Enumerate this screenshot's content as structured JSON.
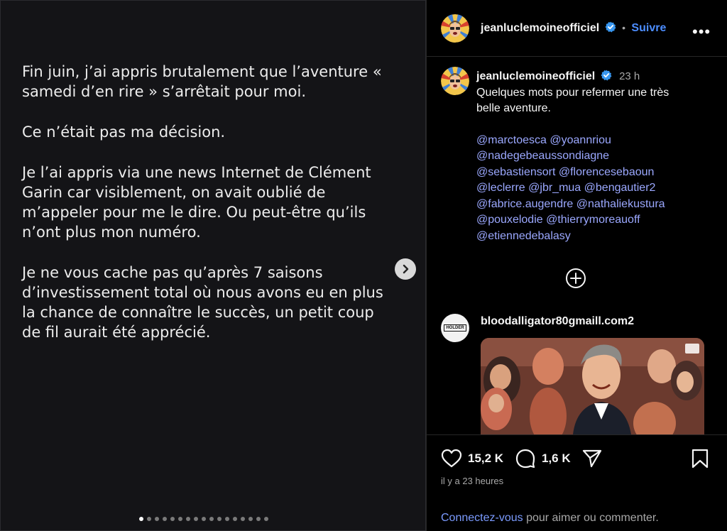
{
  "slide": {
    "paragraphs": [
      "Fin juin, j’ai appris brutalement que l’aventure « samedi d’en rire » s’arrêtait pour moi.",
      "Ce n’était pas ma décision.",
      "Je l’ai appris via une news Internet de Clément Garin car visiblement, on avait oublié de m’appeler pour me le dire. Ou peut-être qu’ils n’ont plus mon numéro.",
      "Je ne vous cache pas qu’après 7 saisons d’investissement total où nous avons eu en plus la chance de connaître le succès, un petit coup de fil aurait été apprécié."
    ],
    "next_icon": "chevron-right-icon",
    "dot_count": 17,
    "active_dot": 0
  },
  "header": {
    "username": "jeanluclemoineofficiel",
    "separator": "•",
    "follow_label": "Suivre",
    "more_icon": "more-horizontal-icon",
    "more_glyph": "•••"
  },
  "caption": {
    "username": "jeanluclemoineofficiel",
    "time": "23 h",
    "text_line1": "Quelques mots pour refermer une très",
    "text_line2": "belle aventure.",
    "mentions": [
      [
        "@marctoesca",
        "@yoannriou"
      ],
      [
        "@nadegebeaussondiagne"
      ],
      [
        "@sebastiensort",
        "@florencesebaoun"
      ],
      [
        "@leclerre",
        "@jbr_mua",
        "@bengautier2"
      ],
      [
        "@fabrice.augendre",
        "@nathaliekustura"
      ],
      [
        "@pouxelodie",
        "@thierrymoreauoff"
      ],
      [
        "@etiennedebalasy"
      ]
    ]
  },
  "comment": {
    "username": "bloodalligator80gmaill.com2",
    "avatar_text": "HOLDER"
  },
  "actions": {
    "likes": "15,2 K",
    "comments": "1,6 K",
    "ago": "il y a 23 heures",
    "login_link": "Connectez-vous",
    "login_rest": " pour aimer ou commenter."
  },
  "colors": {
    "accent": "#4c8dff",
    "mention": "#9ba8ff",
    "verified": "#3897f0"
  }
}
